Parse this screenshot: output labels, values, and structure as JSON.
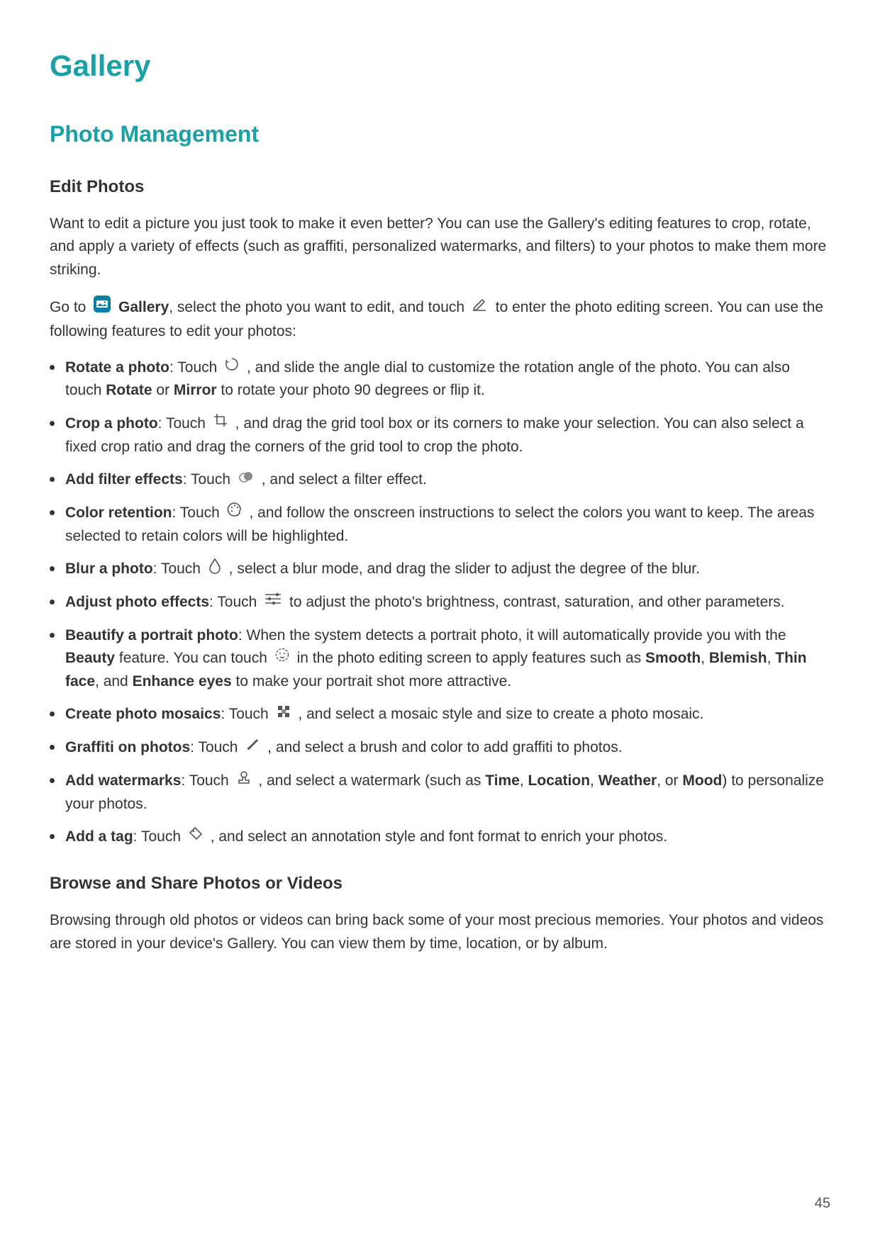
{
  "pageTitle": "Gallery",
  "sectionTitle": "Photo Management",
  "editPhotos": {
    "heading": "Edit Photos",
    "intro": "Want to edit a picture you just took to make it even better? You can use the Gallery's editing features to crop, rotate, and apply a variety of effects (such as graffiti, personalized watermarks, and filters) to your photos to make them more striking.",
    "intro2a": "Go to ",
    "appName": "Gallery",
    "intro2b": ", select the photo you want to edit, and touch ",
    "intro2c": " to enter the photo editing screen. You can use the following features to edit your photos:",
    "items": {
      "rotate": {
        "title": "Rotate a photo",
        "pre": ": Touch ",
        "post1": " , and slide the angle dial to customize the rotation angle of the photo. You can also touch ",
        "rotateWord": "Rotate",
        "or": " or ",
        "mirrorWord": "Mirror",
        "post2": " to rotate your photo 90 degrees or flip it."
      },
      "crop": {
        "title": "Crop a photo",
        "pre": ": Touch ",
        "post": " , and drag the grid tool box or its corners to make your selection. You can also select a fixed crop ratio and drag the corners of the grid tool to crop the photo."
      },
      "filter": {
        "title": "Add filter effects",
        "pre": ": Touch ",
        "post": " , and select a filter effect."
      },
      "color": {
        "title": "Color retention",
        "pre": ": Touch ",
        "post": " , and follow the onscreen instructions to select the colors you want to keep. The areas selected to retain colors will be highlighted."
      },
      "blur": {
        "title": "Blur a photo",
        "pre": ": Touch ",
        "post": " , select a blur mode, and drag the slider to adjust the degree of the blur."
      },
      "adjust": {
        "title": "Adjust photo effects",
        "pre": ": Touch ",
        "post": " to adjust the photo's brightness, contrast, saturation, and other parameters."
      },
      "beautify": {
        "title": "Beautify a portrait photo",
        "pre": ": When the system detects a portrait photo, it will automatically provide you with the ",
        "beautyWord": "Beauty",
        "mid": " feature. You can touch ",
        "post1": " in the photo editing screen to apply features such as ",
        "smooth": "Smooth",
        "c1": ", ",
        "blemish": "Blemish",
        "c2": ", ",
        "thinface": "Thin face",
        "c3": ", and ",
        "enhance": "Enhance eyes",
        "post2": " to make your portrait shot more attractive."
      },
      "mosaic": {
        "title": "Create photo mosaics",
        "pre": ": Touch ",
        "post": " , and select a mosaic style and size to create a photo mosaic."
      },
      "graffiti": {
        "title": "Graffiti on photos",
        "pre": ": Touch ",
        "post": " , and select a brush and color to add graffiti to photos."
      },
      "watermark": {
        "title": "Add watermarks",
        "pre": ": Touch ",
        "post1": " , and select a watermark (such as ",
        "time": "Time",
        "c1": ", ",
        "loc": "Location",
        "c2": ", ",
        "weather": "Weather",
        "c3": ", or ",
        "mood": "Mood",
        "post2": ") to personalize your photos."
      },
      "tag": {
        "title": "Add a tag",
        "pre": ": Touch ",
        "post": " , and select an annotation style and font format to enrich your photos."
      }
    }
  },
  "browse": {
    "heading": "Browse and Share Photos or Videos",
    "para": "Browsing through old photos or videos can bring back some of your most precious memories. Your photos and videos are stored in your device's Gallery. You can view them by time, location, or by album."
  },
  "pageNumber": "45"
}
